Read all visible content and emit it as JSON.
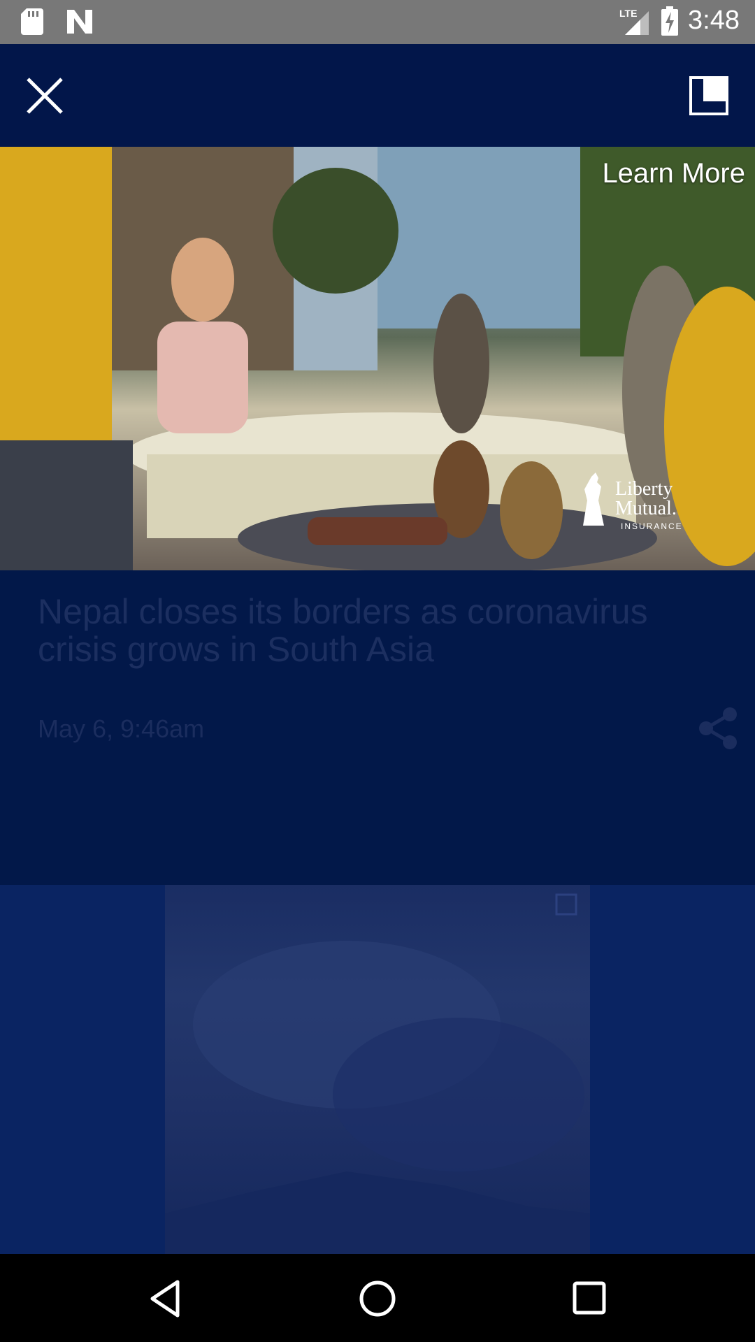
{
  "status_bar": {
    "time": "3:48",
    "network": "LTE",
    "icons": [
      "sd-card-icon",
      "n-notification-icon",
      "signal-icon",
      "battery-charging-icon"
    ]
  },
  "top_bar": {
    "close_icon": "close-icon",
    "pip_icon": "picture-in-picture-icon"
  },
  "video": {
    "learn_more_label": "Learn More",
    "logo_line1": "Liberty",
    "logo_line2": "Mutual.",
    "logo_line3": "INSURANCE"
  },
  "article": {
    "headline": "Nepal closes its borders as coronavirus crisis grows in South Asia",
    "date": "May 6, 9:46am",
    "share_icon": "share-icon"
  },
  "nav_bar": {
    "icons": [
      "back-icon",
      "home-icon",
      "recents-icon"
    ]
  },
  "colors": {
    "header_bg": "#02164a",
    "article_bg": "#021849",
    "status_bg": "#787878",
    "nav_bg": "#000000"
  }
}
